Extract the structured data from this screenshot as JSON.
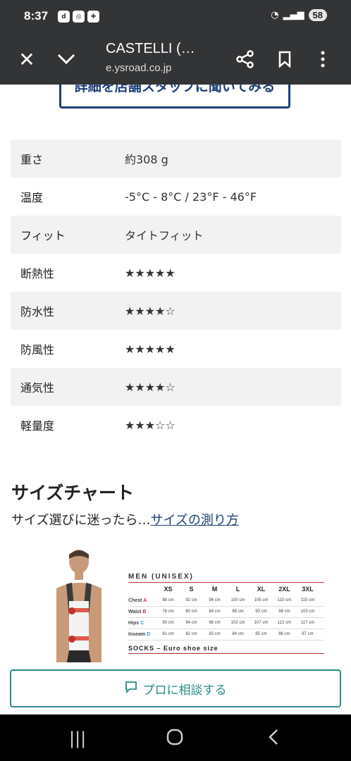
{
  "status": {
    "time": "8:37",
    "battery": "58"
  },
  "browser": {
    "title": "CASTELLI (…",
    "url": "e.ysroad.co.jp"
  },
  "store_button": "詳細を店舗スタッフに聞いてみる",
  "specs": [
    {
      "label": "重さ",
      "value": "約308 g"
    },
    {
      "label": "温度",
      "value": "-5°C - 8°C / 23°F - 46°F"
    },
    {
      "label": "フィット",
      "value": "タイトフィット"
    },
    {
      "label": "断熱性",
      "value": "★★★★★"
    },
    {
      "label": "防水性",
      "value": "★★★★☆"
    },
    {
      "label": "防風性",
      "value": "★★★★★"
    },
    {
      "label": "通気性",
      "value": "★★★★☆"
    },
    {
      "label": "軽量度",
      "value": "★★★☆☆"
    }
  ],
  "size": {
    "heading": "サイズチャート",
    "sub_text": "サイズ選びに迷ったら…",
    "sub_link": "サイズの測り方",
    "table_title": "MEN (UNISEX)",
    "headers": [
      "XS",
      "S",
      "M",
      "L",
      "XL",
      "2XL",
      "3XL"
    ],
    "rows": [
      {
        "label": "Chest",
        "marker": "A",
        "values": [
          "88 cm",
          "92 cm",
          "96 cm",
          "100 cm",
          "105 cm",
          "110 cm",
          "115 cm"
        ]
      },
      {
        "label": "Waist",
        "marker": "B",
        "values": [
          "76 cm",
          "80 cm",
          "84 cm",
          "88 cm",
          "93 cm",
          "98 cm",
          "103 cm"
        ]
      },
      {
        "label": "Hips",
        "marker": "C",
        "values": [
          "90 cm",
          "94 cm",
          "98 cm",
          "102 cm",
          "107 cm",
          "112 cm",
          "117 cm"
        ]
      },
      {
        "label": "Inseam",
        "marker": "D",
        "values": [
          "81 cm",
          "82 cm",
          "83 cm",
          "84 cm",
          "85 cm",
          "86 cm",
          "87 cm"
        ]
      }
    ],
    "socks_title": "SOCKS – Euro shoe size"
  },
  "consult_button": "プロに相談する"
}
